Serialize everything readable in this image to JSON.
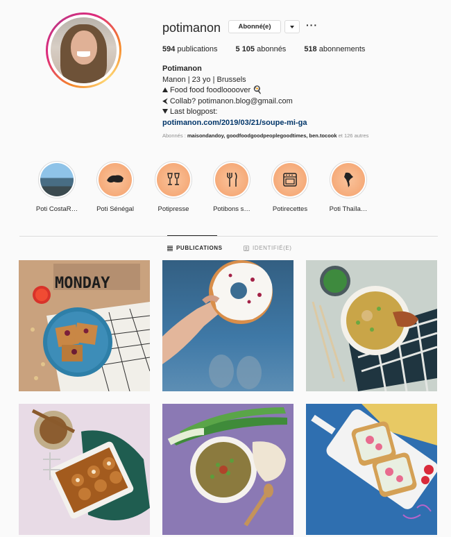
{
  "profile": {
    "username": "potimanon",
    "follow_label": "Abonné(e)",
    "more_label": "···",
    "stats": [
      {
        "value": "594",
        "label": " publications"
      },
      {
        "value": "5 105",
        "label": " abonnés"
      },
      {
        "value": "518",
        "label": " abonnements"
      }
    ],
    "bio": {
      "name": "Potimanon",
      "line1": "Manon | 23 yo | Brussels",
      "line2": "Food food foodloooover 🍳",
      "line3": "⮜ Collab? potimanon.blog@gmail.com",
      "line4": "Last blogpost:",
      "link": "potimanon.com/2019/03/21/soupe-mi-ga"
    },
    "followed_by_prefix": "Abonnés : ",
    "followed_by_names": "maisondandoy, goodfoodgoodpeoplegoodtimes, ben.tocook",
    "followed_by_suffix": " et 126 autres"
  },
  "highlights": [
    {
      "label": "Poti CostaR…",
      "icon": "sea-photo"
    },
    {
      "label": "Poti Sénégal",
      "icon": "senegal-map-icon"
    },
    {
      "label": "Potipresse",
      "icon": "wine-glasses-icon"
    },
    {
      "label": "Potibons s…",
      "icon": "fork-knife-icon"
    },
    {
      "label": "Potirecettes",
      "icon": "oven-icon"
    },
    {
      "label": "Poti Thaïla…",
      "icon": "thailand-map-icon"
    }
  ],
  "tabs": {
    "publications": "PUBLICATIONS",
    "tagged": "IDENTIFIÉ(E)"
  },
  "posts": [
    {
      "subject": "monday-waffles"
    },
    {
      "subject": "donut-in-hand"
    },
    {
      "subject": "chicken-soup"
    },
    {
      "subject": "cinnamon-rolls"
    },
    {
      "subject": "green-onion-dip"
    },
    {
      "subject": "radish-toasts"
    }
  ],
  "post1_sign": "MONDAY",
  "colors": {
    "link": "#003569",
    "muted": "#8e8e8e",
    "border": "#dbdbdb"
  }
}
